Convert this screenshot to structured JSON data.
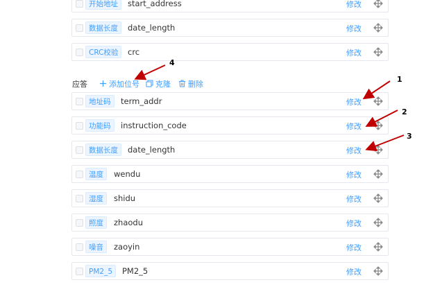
{
  "top_rows": [
    {
      "tag": "开始地址",
      "field": "start_address",
      "edit": "修改"
    },
    {
      "tag": "数据长度",
      "field": "date_length",
      "edit": "修改"
    },
    {
      "tag": "CRC校验",
      "field": "crc",
      "edit": "修改"
    }
  ],
  "response": {
    "label": "应答",
    "add_label": "添加位号",
    "clone_label": "克隆",
    "delete_label": "删除"
  },
  "response_rows": [
    {
      "tag": "地址码",
      "field": "term_addr",
      "edit": "修改"
    },
    {
      "tag": "功能码",
      "field": "instruction_code",
      "edit": "修改"
    },
    {
      "tag": "数据长度",
      "field": "date_length",
      "edit": "修改"
    },
    {
      "tag": "温度",
      "field": "wendu",
      "edit": "修改"
    },
    {
      "tag": "湿度",
      "field": "shidu",
      "edit": "修改"
    },
    {
      "tag": "照度",
      "field": "zhaodu",
      "edit": "修改"
    },
    {
      "tag": "噪音",
      "field": "zaoyin",
      "edit": "修改"
    },
    {
      "tag": "PM2_5",
      "field": "PM2_5",
      "edit": "修改"
    }
  ],
  "annotations": [
    "1",
    "2",
    "3",
    "4"
  ],
  "colors": {
    "accent": "#409eff",
    "arrow": "#c00000",
    "border": "#e4e7ed"
  }
}
